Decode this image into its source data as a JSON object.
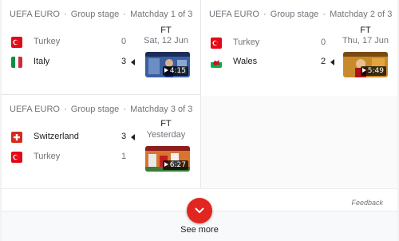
{
  "matches": [
    {
      "competition": "UEFA EURO",
      "stage": "Group stage",
      "matchday": "Matchday 1 of 3",
      "status": "FT",
      "date": "Sat, 12 Jun",
      "home": {
        "name": "Turkey",
        "score": "0",
        "flag": "turkey"
      },
      "away": {
        "name": "Italy",
        "score": "3",
        "flag": "italy"
      },
      "winner": "away",
      "highlight_duration": "4:15"
    },
    {
      "competition": "UEFA EURO",
      "stage": "Group stage",
      "matchday": "Matchday 2 of 3",
      "status": "FT",
      "date": "Thu, 17 Jun",
      "home": {
        "name": "Turkey",
        "score": "0",
        "flag": "turkey"
      },
      "away": {
        "name": "Wales",
        "score": "2",
        "flag": "wales"
      },
      "winner": "away",
      "highlight_duration": "5:49"
    },
    {
      "competition": "UEFA EURO",
      "stage": "Group stage",
      "matchday": "Matchday 3 of 3",
      "status": "FT",
      "date": "Yesterday",
      "home": {
        "name": "Switzerland",
        "score": "3",
        "flag": "switzerland"
      },
      "away": {
        "name": "Turkey",
        "score": "1",
        "flag": "turkey"
      },
      "winner": "home",
      "highlight_duration": "6:27"
    }
  ],
  "separator": "·",
  "feedback_label": "Feedback",
  "see_more_label": "See more",
  "colors": {
    "accent_red": "#e0261f",
    "muted_text": "#70757a",
    "primary_text": "#202124"
  }
}
